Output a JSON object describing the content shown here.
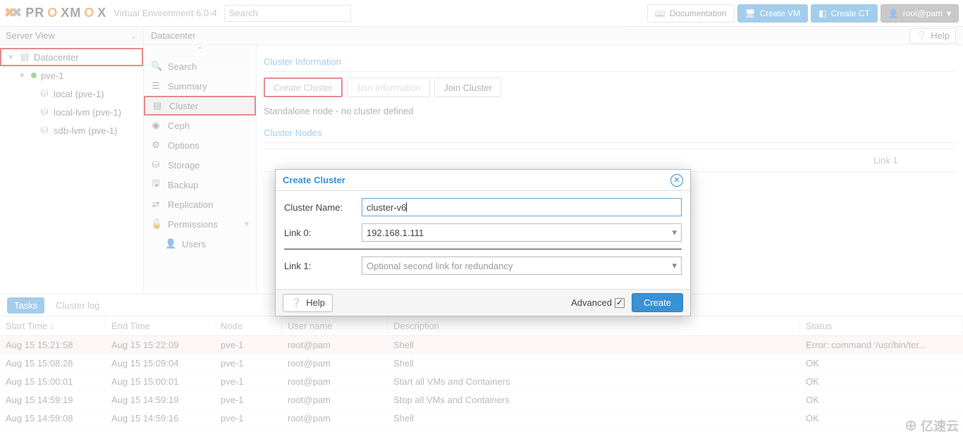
{
  "header": {
    "logo_text": "PROXMOX",
    "env_label": "Virtual Environment 6.0-4",
    "search_placeholder": "Search",
    "doc_label": "Documentation",
    "create_vm_label": "Create VM",
    "create_ct_label": "Create CT",
    "user_label": "root@pam"
  },
  "server_view": {
    "title": "Server View",
    "nodes": {
      "datacenter": "Datacenter",
      "pve1": "pve-1",
      "local": "local (pve-1)",
      "local_lvm": "local-lvm (pve-1)",
      "sdb_lvm": "sdb-lvm (pve-1)"
    }
  },
  "breadcrumb": "Datacenter",
  "help_btn": "Help",
  "submenu": {
    "search": "Search",
    "summary": "Summary",
    "cluster": "Cluster",
    "ceph": "Ceph",
    "options": "Options",
    "storage": "Storage",
    "backup": "Backup",
    "replication": "Replication",
    "permissions": "Permissions",
    "users": "Users"
  },
  "panel": {
    "title": "Cluster Information",
    "create_cluster": "Create Cluster",
    "join_info": "Join Information",
    "join_cluster": "Join Cluster",
    "status": "Standalone node - no cluster defined",
    "nodes_title": "Cluster Nodes",
    "col_link1": "Link 1"
  },
  "modal": {
    "title": "Create Cluster",
    "name_label": "Cluster Name:",
    "name_value": "cluster-v6",
    "link0_label": "Link 0:",
    "link0_value": "192.168.1.111",
    "link1_label": "Link 1:",
    "link1_placeholder": "Optional second link for redundancy",
    "help": "Help",
    "advanced": "Advanced",
    "create": "Create"
  },
  "tasks": {
    "tab_tasks": "Tasks",
    "tab_cluster": "Cluster log",
    "cols": {
      "start": "Start Time ↓",
      "end": "End Time",
      "node": "Node",
      "user": "User name",
      "desc": "Description",
      "status": "Status"
    },
    "rows": [
      {
        "start": "Aug 15 15:21:58",
        "end": "Aug 15 15:22:09",
        "node": "pve-1",
        "user": "root@pam",
        "desc": "Shell",
        "status": "Error: command '/usr/bin/ter...",
        "err": true
      },
      {
        "start": "Aug 15 15:08:28",
        "end": "Aug 15 15:09:04",
        "node": "pve-1",
        "user": "root@pam",
        "desc": "Shell",
        "status": "OK"
      },
      {
        "start": "Aug 15 15:00:01",
        "end": "Aug 15 15:00:01",
        "node": "pve-1",
        "user": "root@pam",
        "desc": "Start all VMs and Containers",
        "status": "OK"
      },
      {
        "start": "Aug 15 14:59:19",
        "end": "Aug 15 14:59:19",
        "node": "pve-1",
        "user": "root@pam",
        "desc": "Stop all VMs and Containers",
        "status": "OK"
      },
      {
        "start": "Aug 15 14:59:08",
        "end": "Aug 15 14:59:16",
        "node": "pve-1",
        "user": "root@pam",
        "desc": "Shell",
        "status": "OK"
      }
    ]
  },
  "watermark": "亿速云"
}
